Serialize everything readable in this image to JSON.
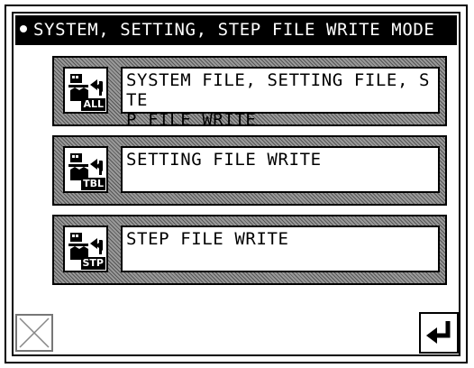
{
  "title": "SYSTEM, SETTING, STEP FILE WRITE MODE",
  "options": [
    {
      "label": "SYSTEM FILE, SETTING FILE, STE\nP FILE WRITE",
      "icon_tag": "ALL",
      "icon": "file-write-all-icon"
    },
    {
      "label": "SETTING FILE WRITE",
      "icon_tag": "TBL",
      "icon": "file-write-table-icon"
    },
    {
      "label": "STEP FILE WRITE",
      "icon_tag": "STP",
      "icon": "file-write-step-icon"
    }
  ],
  "buttons": {
    "cancel_icon": "close-icon",
    "enter_icon": "enter-icon"
  }
}
